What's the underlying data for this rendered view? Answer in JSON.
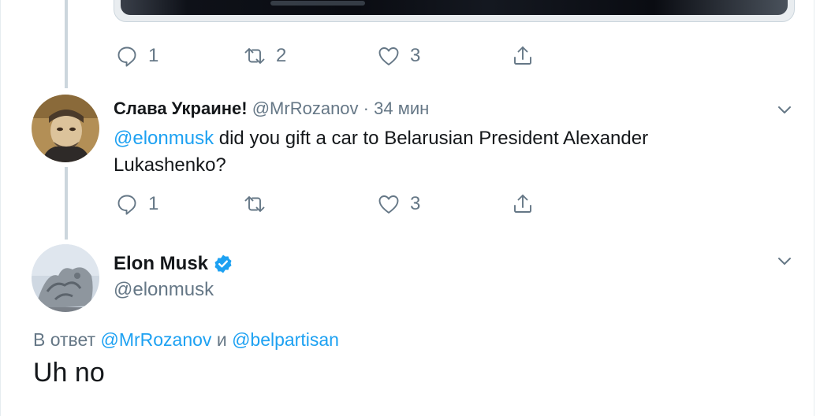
{
  "tweet_prev": {
    "reply_count": "1",
    "retweet_count": "2",
    "like_count": "3"
  },
  "reply": {
    "display_name": "Слава Украине!",
    "handle": "@MrRozanov",
    "separator": "·",
    "time": "34 мин",
    "mention": "@elonmusk",
    "text_line1": "did you gift a car to Belarusian President Alexander",
    "text_line2": "Lukashenko?",
    "reply_count": "1",
    "like_count": "3"
  },
  "main": {
    "display_name": "Elon Musk",
    "handle": "@elonmusk",
    "reply_prefix": "В ответ",
    "reply_to_1": "@MrRozanov",
    "reply_conj": "и",
    "reply_to_2": "@belpartisan",
    "text": "Uh no"
  },
  "colors": {
    "link": "#1da1f2",
    "secondary_text": "#657786",
    "verified": "#1da1f2",
    "thread_line": "#ccd6dd"
  },
  "icons": [
    "reply-icon",
    "retweet-icon",
    "like-icon",
    "share-icon",
    "chevron-down-icon",
    "verified-badge-icon"
  ]
}
